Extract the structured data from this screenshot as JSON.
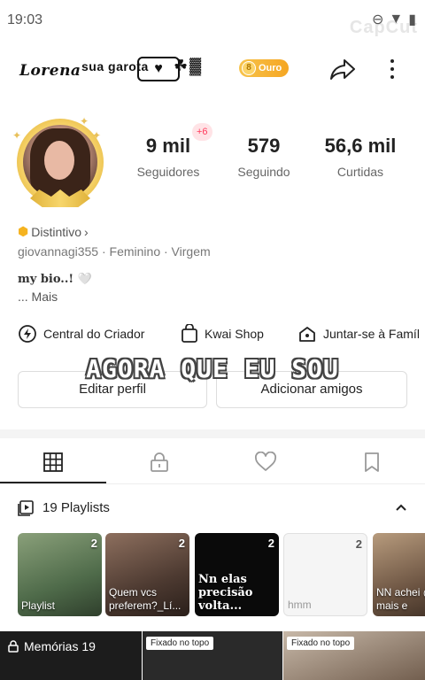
{
  "status_bar": {
    "time": "19:03",
    "watermark": "CapCut"
  },
  "header": {
    "logo_text": "Lorena",
    "name": "sua garota",
    "name_decor": "♥",
    "decor_glyphs": "☘▓",
    "level_badge": "Ouro",
    "share_icon": "share-icon",
    "more_icon": "more-vertical-icon"
  },
  "profile": {
    "new_followers_badge": "+6",
    "stats": [
      {
        "value": "9 mil",
        "label": "Seguidores"
      },
      {
        "value": "579",
        "label": "Seguindo"
      },
      {
        "value": "56,6 mil",
        "label": "Curtidas"
      }
    ],
    "distinctive": "Distintivo",
    "meta": "giovannagi355 · Feminino · Virgem",
    "bio": "my bio..! 🤍",
    "bio_more": "... Mais"
  },
  "shortcuts": [
    {
      "label": "Central do Criador",
      "icon": "lightning-icon"
    },
    {
      "label": "Kwai Shop",
      "icon": "shopping-bag-icon"
    },
    {
      "label": "Juntar-se à Famíl",
      "icon": "family-house-icon"
    }
  ],
  "overlay_caption": "AGORA QUE EU SOU",
  "actions": {
    "edit_profile": "Editar perfil",
    "add_friends": "Adicionar amigos"
  },
  "tabs": [
    {
      "name": "grid",
      "icon": "grid-icon",
      "active": true
    },
    {
      "name": "private",
      "icon": "lock-icon",
      "active": false
    },
    {
      "name": "liked",
      "icon": "heart-icon",
      "active": false
    },
    {
      "name": "saved",
      "icon": "bookmark-icon",
      "active": false
    }
  ],
  "playlists": {
    "label": "19 Playlists",
    "cards": [
      {
        "count": "2",
        "title": "Playlist"
      },
      {
        "count": "2",
        "title": "Quem vcs preferem?_Lí..."
      },
      {
        "count": "2",
        "title": "Nn elas precisão volta..."
      },
      {
        "count": "2",
        "title": "hmm"
      },
      {
        "count": "",
        "title": "NN achei @ mais e"
      }
    ]
  },
  "bottom_tiles": {
    "memories": "Memórias 19",
    "pinned_1": "Fixado no topo",
    "pinned_2": "Fixado no topo"
  },
  "colors": {
    "accent": "#ff3b5c",
    "gold": "#f5a623",
    "text_primary": "#222222",
    "text_secondary": "#666666"
  }
}
